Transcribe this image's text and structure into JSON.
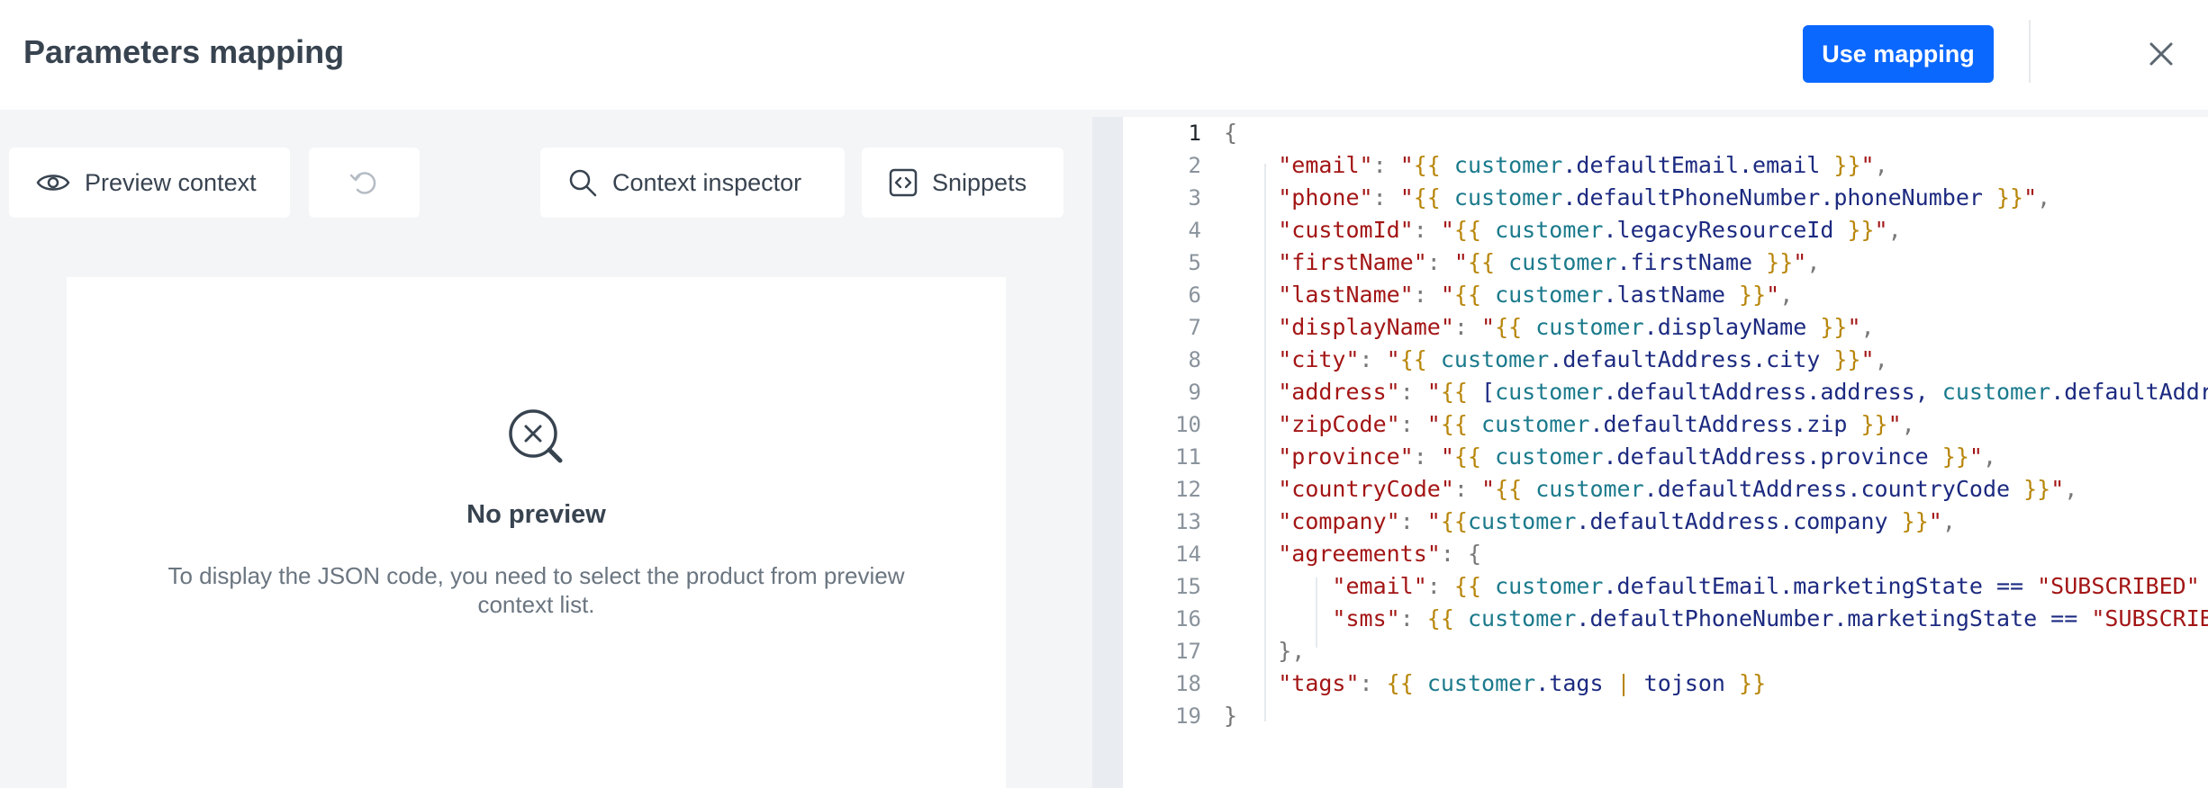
{
  "header": {
    "title": "Parameters mapping",
    "use_mapping_label": "Use mapping"
  },
  "toolbar": {
    "preview_context_label": "Preview context",
    "context_inspector_label": "Context inspector",
    "snippets_label": "Snippets"
  },
  "preview": {
    "empty_title": "No preview",
    "empty_description": "To display the JSON code, you need to select the product from preview context list."
  },
  "editor": {
    "active_line": 1,
    "lines": [
      {
        "num": "1",
        "tokens": [
          [
            "{",
            "punc"
          ]
        ]
      },
      {
        "num": "2",
        "tokens": [
          [
            "    ",
            "ws"
          ],
          [
            "\"email\"",
            "key"
          ],
          [
            ": ",
            "punc"
          ],
          [
            "\"",
            "str"
          ],
          [
            "{{",
            "brace"
          ],
          [
            " ",
            "ws"
          ],
          [
            "customer",
            "ctx"
          ],
          [
            ".defaultEmail.email",
            "prop"
          ],
          [
            " ",
            "ws"
          ],
          [
            "}}",
            "brace"
          ],
          [
            "\"",
            "str"
          ],
          [
            ",",
            "punc"
          ]
        ]
      },
      {
        "num": "3",
        "tokens": [
          [
            "    ",
            "ws"
          ],
          [
            "\"phone\"",
            "key"
          ],
          [
            ": ",
            "punc"
          ],
          [
            "\"",
            "str"
          ],
          [
            "{{",
            "brace"
          ],
          [
            " ",
            "ws"
          ],
          [
            "customer",
            "ctx"
          ],
          [
            ".defaultPhoneNumber.phoneNumber",
            "prop"
          ],
          [
            " ",
            "ws"
          ],
          [
            "}}",
            "brace"
          ],
          [
            "\"",
            "str"
          ],
          [
            ",",
            "punc"
          ]
        ]
      },
      {
        "num": "4",
        "tokens": [
          [
            "    ",
            "ws"
          ],
          [
            "\"customId\"",
            "key"
          ],
          [
            ": ",
            "punc"
          ],
          [
            "\"",
            "str"
          ],
          [
            "{{",
            "brace"
          ],
          [
            " ",
            "ws"
          ],
          [
            "customer",
            "ctx"
          ],
          [
            ".legacyResourceId",
            "prop"
          ],
          [
            " ",
            "ws"
          ],
          [
            "}}",
            "brace"
          ],
          [
            "\"",
            "str"
          ],
          [
            ",",
            "punc"
          ]
        ]
      },
      {
        "num": "5",
        "tokens": [
          [
            "    ",
            "ws"
          ],
          [
            "\"firstName\"",
            "key"
          ],
          [
            ": ",
            "punc"
          ],
          [
            "\"",
            "str"
          ],
          [
            "{{",
            "brace"
          ],
          [
            " ",
            "ws"
          ],
          [
            "customer",
            "ctx"
          ],
          [
            ".firstName",
            "prop"
          ],
          [
            " ",
            "ws"
          ],
          [
            "}}",
            "brace"
          ],
          [
            "\"",
            "str"
          ],
          [
            ",",
            "punc"
          ]
        ]
      },
      {
        "num": "6",
        "tokens": [
          [
            "    ",
            "ws"
          ],
          [
            "\"lastName\"",
            "key"
          ],
          [
            ": ",
            "punc"
          ],
          [
            "\"",
            "str"
          ],
          [
            "{{",
            "brace"
          ],
          [
            " ",
            "ws"
          ],
          [
            "customer",
            "ctx"
          ],
          [
            ".lastName",
            "prop"
          ],
          [
            " ",
            "ws"
          ],
          [
            "}}",
            "brace"
          ],
          [
            "\"",
            "str"
          ],
          [
            ",",
            "punc"
          ]
        ]
      },
      {
        "num": "7",
        "tokens": [
          [
            "    ",
            "ws"
          ],
          [
            "\"displayName\"",
            "key"
          ],
          [
            ": ",
            "punc"
          ],
          [
            "\"",
            "str"
          ],
          [
            "{{",
            "brace"
          ],
          [
            " ",
            "ws"
          ],
          [
            "customer",
            "ctx"
          ],
          [
            ".displayName",
            "prop"
          ],
          [
            " ",
            "ws"
          ],
          [
            "}}",
            "brace"
          ],
          [
            "\"",
            "str"
          ],
          [
            ",",
            "punc"
          ]
        ]
      },
      {
        "num": "8",
        "tokens": [
          [
            "    ",
            "ws"
          ],
          [
            "\"city\"",
            "key"
          ],
          [
            ": ",
            "punc"
          ],
          [
            "\"",
            "str"
          ],
          [
            "{{",
            "brace"
          ],
          [
            " ",
            "ws"
          ],
          [
            "customer",
            "ctx"
          ],
          [
            ".defaultAddress.city",
            "prop"
          ],
          [
            " ",
            "ws"
          ],
          [
            "}}",
            "brace"
          ],
          [
            "\"",
            "str"
          ],
          [
            ",",
            "punc"
          ]
        ]
      },
      {
        "num": "9",
        "tokens": [
          [
            "    ",
            "ws"
          ],
          [
            "\"address\"",
            "key"
          ],
          [
            ": ",
            "punc"
          ],
          [
            "\"",
            "str"
          ],
          [
            "{{",
            "brace"
          ],
          [
            " [",
            "prop"
          ],
          [
            "customer",
            "ctx"
          ],
          [
            ".defaultAddress.address, ",
            "prop"
          ],
          [
            "customer",
            "ctx"
          ],
          [
            ".defaultAddres",
            "prop"
          ]
        ]
      },
      {
        "num": "10",
        "tokens": [
          [
            "    ",
            "ws"
          ],
          [
            "\"zipCode\"",
            "key"
          ],
          [
            ": ",
            "punc"
          ],
          [
            "\"",
            "str"
          ],
          [
            "{{",
            "brace"
          ],
          [
            " ",
            "ws"
          ],
          [
            "customer",
            "ctx"
          ],
          [
            ".defaultAddress.zip",
            "prop"
          ],
          [
            " ",
            "ws"
          ],
          [
            "}}",
            "brace"
          ],
          [
            "\"",
            "str"
          ],
          [
            ",",
            "punc"
          ]
        ]
      },
      {
        "num": "11",
        "tokens": [
          [
            "    ",
            "ws"
          ],
          [
            "\"province\"",
            "key"
          ],
          [
            ": ",
            "punc"
          ],
          [
            "\"",
            "str"
          ],
          [
            "{{",
            "brace"
          ],
          [
            " ",
            "ws"
          ],
          [
            "customer",
            "ctx"
          ],
          [
            ".defaultAddress.province",
            "prop"
          ],
          [
            " ",
            "ws"
          ],
          [
            "}}",
            "brace"
          ],
          [
            "\"",
            "str"
          ],
          [
            ",",
            "punc"
          ]
        ]
      },
      {
        "num": "12",
        "tokens": [
          [
            "    ",
            "ws"
          ],
          [
            "\"countryCode\"",
            "key"
          ],
          [
            ": ",
            "punc"
          ],
          [
            "\"",
            "str"
          ],
          [
            "{{",
            "brace"
          ],
          [
            " ",
            "ws"
          ],
          [
            "customer",
            "ctx"
          ],
          [
            ".defaultAddress.countryCode",
            "prop"
          ],
          [
            " ",
            "ws"
          ],
          [
            "}}",
            "brace"
          ],
          [
            "\"",
            "str"
          ],
          [
            ",",
            "punc"
          ]
        ]
      },
      {
        "num": "13",
        "tokens": [
          [
            "    ",
            "ws"
          ],
          [
            "\"company\"",
            "key"
          ],
          [
            ": ",
            "punc"
          ],
          [
            "\"",
            "str"
          ],
          [
            "{{",
            "brace"
          ],
          [
            "customer",
            "ctx"
          ],
          [
            ".defaultAddress.company",
            "prop"
          ],
          [
            " ",
            "ws"
          ],
          [
            "}}",
            "brace"
          ],
          [
            "\"",
            "str"
          ],
          [
            ",",
            "punc"
          ]
        ]
      },
      {
        "num": "14",
        "tokens": [
          [
            "    ",
            "ws"
          ],
          [
            "\"agreements\"",
            "key"
          ],
          [
            ": {",
            "punc"
          ]
        ]
      },
      {
        "num": "15",
        "tokens": [
          [
            "        ",
            "ws"
          ],
          [
            "\"email\"",
            "key"
          ],
          [
            ": ",
            "punc"
          ],
          [
            "{{",
            "brace"
          ],
          [
            " ",
            "ws"
          ],
          [
            "customer",
            "ctx"
          ],
          [
            ".defaultEmail.marketingState == ",
            "prop"
          ],
          [
            "\"SUBSCRIBED\"",
            "str"
          ],
          [
            " ",
            "ws"
          ],
          [
            "}}",
            "brace"
          ]
        ]
      },
      {
        "num": "16",
        "tokens": [
          [
            "        ",
            "ws"
          ],
          [
            "\"sms\"",
            "key"
          ],
          [
            ": ",
            "punc"
          ],
          [
            "{{",
            "brace"
          ],
          [
            " ",
            "ws"
          ],
          [
            "customer",
            "ctx"
          ],
          [
            ".defaultPhoneNumber.marketingState == ",
            "prop"
          ],
          [
            "\"SUBSCRIBED",
            "str"
          ]
        ]
      },
      {
        "num": "17",
        "tokens": [
          [
            "    ",
            "ws"
          ],
          [
            "},",
            "punc"
          ]
        ]
      },
      {
        "num": "18",
        "tokens": [
          [
            "    ",
            "ws"
          ],
          [
            "\"tags\"",
            "key"
          ],
          [
            ": ",
            "punc"
          ],
          [
            "{{",
            "brace"
          ],
          [
            " ",
            "ws"
          ],
          [
            "customer",
            "ctx"
          ],
          [
            ".tags ",
            "prop"
          ],
          [
            "|",
            "brace"
          ],
          [
            " tojson ",
            "prop"
          ],
          [
            "}}",
            "brace"
          ]
        ]
      },
      {
        "num": "19",
        "tokens": [
          [
            "}",
            "punc"
          ]
        ]
      }
    ]
  },
  "colors": {
    "primary": "#0b68ff",
    "panel_bg": "#f3f5f7",
    "json_key": "#a31515",
    "template_brace": "#b8860b",
    "context_var": "#1b7a8c",
    "property": "#1c2a80"
  }
}
